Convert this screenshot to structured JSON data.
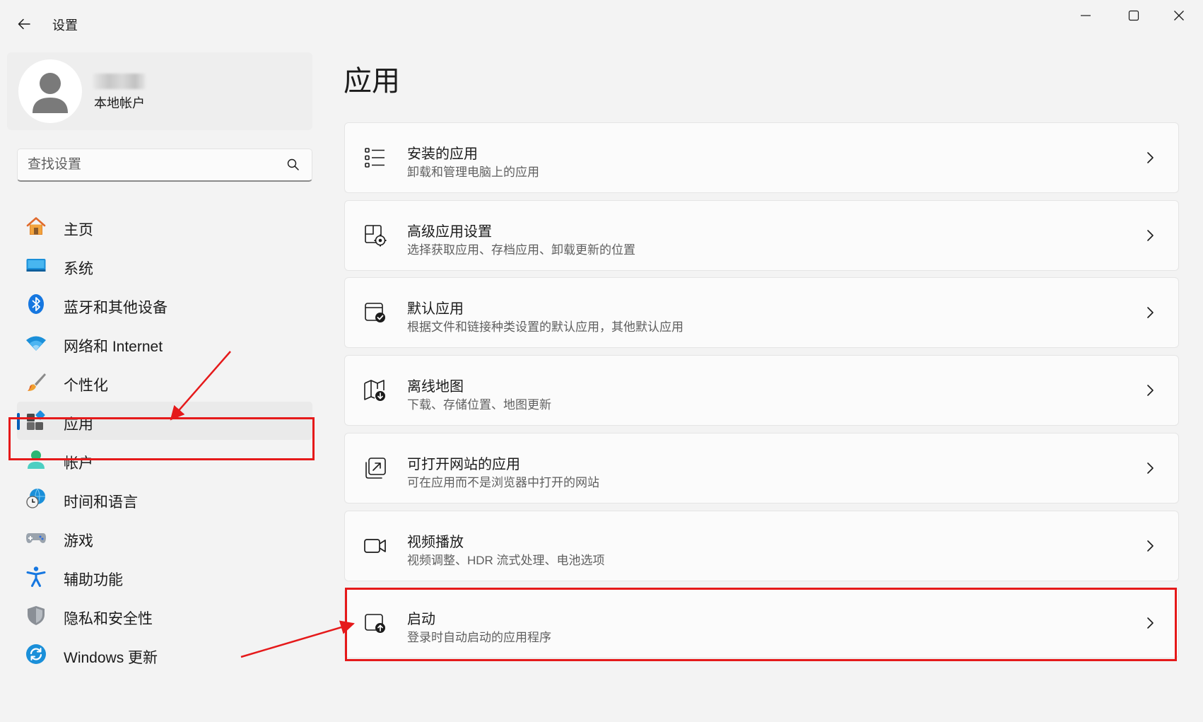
{
  "window": {
    "title": "设置"
  },
  "profile": {
    "account_type": "本地帐户"
  },
  "search": {
    "placeholder": "查找设置"
  },
  "sidebar": {
    "items": [
      {
        "label": "主页",
        "icon": "home-icon"
      },
      {
        "label": "系统",
        "icon": "system-icon"
      },
      {
        "label": "蓝牙和其他设备",
        "icon": "bluetooth-icon"
      },
      {
        "label": "网络和 Internet",
        "icon": "wifi-icon"
      },
      {
        "label": "个性化",
        "icon": "brush-icon"
      },
      {
        "label": "应用",
        "icon": "apps-icon",
        "selected": true
      },
      {
        "label": "帐户",
        "icon": "account-icon"
      },
      {
        "label": "时间和语言",
        "icon": "time-language-icon"
      },
      {
        "label": "游戏",
        "icon": "gamepad-icon"
      },
      {
        "label": "辅助功能",
        "icon": "accessibility-icon"
      },
      {
        "label": "隐私和安全性",
        "icon": "shield-icon"
      },
      {
        "label": "Windows 更新",
        "icon": "windows-update-icon"
      }
    ]
  },
  "main": {
    "title": "应用",
    "cards": [
      {
        "title": "安装的应用",
        "subtitle": "卸载和管理电脑上的应用",
        "icon": "installed-apps-icon"
      },
      {
        "title": "高级应用设置",
        "subtitle": "选择获取应用、存档应用、卸载更新的位置",
        "icon": "advanced-apps-icon"
      },
      {
        "title": "默认应用",
        "subtitle": "根据文件和链接种类设置的默认应用，其他默认应用",
        "icon": "default-apps-icon"
      },
      {
        "title": "离线地图",
        "subtitle": "下载、存储位置、地图更新",
        "icon": "offline-maps-icon"
      },
      {
        "title": "可打开网站的应用",
        "subtitle": "可在应用而不是浏览器中打开的网站",
        "icon": "apps-for-websites-icon"
      },
      {
        "title": "视频播放",
        "subtitle": "视频调整、HDR 流式处理、电池选项",
        "icon": "video-camera-icon"
      },
      {
        "title": "启动",
        "subtitle": "登录时自动启动的应用程序",
        "icon": "startup-icon"
      }
    ]
  },
  "colors": {
    "accent": "#005fb8",
    "annotation": "#e5191a",
    "background": "#f3f3f3",
    "card": "#fbfbfb"
  }
}
